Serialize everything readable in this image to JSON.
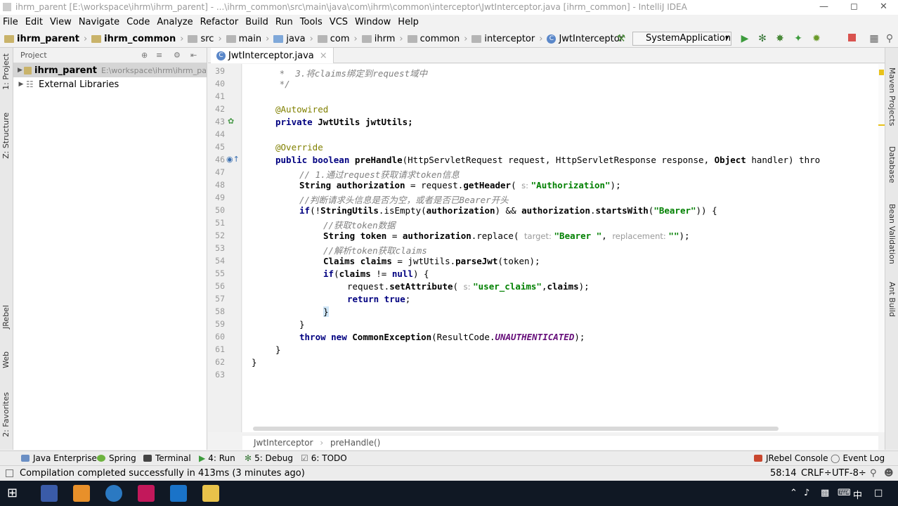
{
  "window": {
    "title": "ihrm_parent [E:\\workspace\\ihrm\\ihrm_parent] - ...\\ihrm_common\\src\\main\\java\\com\\ihrm\\common\\interceptor\\JwtInterceptor.java [ihrm_common] - IntelliJ IDEA"
  },
  "menu": [
    "File",
    "Edit",
    "View",
    "Navigate",
    "Code",
    "Analyze",
    "Refactor",
    "Build",
    "Run",
    "Tools",
    "VCS",
    "Window",
    "Help"
  ],
  "breadcrumbs": [
    "ihrm_parent",
    "ihrm_common",
    "src",
    "main",
    "java",
    "com",
    "ihrm",
    "common",
    "interceptor",
    "JwtInterceptor"
  ],
  "run_config": "SystemApplication",
  "left_tabs": [
    "1: Project",
    "Z: Structure",
    "JRebel",
    "Web",
    "2: Favorites"
  ],
  "right_tabs": [
    "Maven Projects",
    "Database",
    "Bean Validation",
    "Ant Build"
  ],
  "project_panel": {
    "header": "Project",
    "items": [
      {
        "label": "ihrm_parent",
        "path": "E:\\workspace\\ihrm\\ihrm_pa"
      },
      {
        "label": "External Libraries",
        "path": ""
      }
    ]
  },
  "editor": {
    "tab": "JwtInterceptor.java",
    "line_numbers": [
      "39",
      "40",
      "41",
      "42",
      "43",
      "44",
      "45",
      "46",
      "47",
      "48",
      "49",
      "50",
      "51",
      "52",
      "53",
      "54",
      "55",
      "56",
      "57",
      "58",
      "59",
      "60",
      "61",
      "62",
      "63"
    ],
    "lines": {
      "l39": "     *  3.将claims绑定到request域中",
      "l40": "     */",
      "l42": "@Autowired",
      "l43_kw": "private ",
      "l43_rest": "JwtUtils jwtUtils;",
      "l45": "@Override",
      "l46_kw": "public boolean ",
      "l46_fn": "preHandle",
      "l46_rest": "(HttpServletRequest request, HttpServletResponse response, ",
      "l46_obj": "Object",
      "l46_tail": " handler) thro",
      "l47": "// 1.通过request获取请求token信息",
      "l48_a": "String ",
      "l48_b": "authorization",
      "l48_c": " = request.",
      "l48_d": "getHeader",
      "l48_e": "( ",
      "l48_hint": "s: ",
      "l48_str": "\"Authorization\"",
      "l48_end": ");",
      "l49": "//判断请求头信息是否为空，或者是否已Bearer开头",
      "l50_kw": "if",
      "l50_a": "(!",
      "l50_b": "StringUtils",
      "l50_c": ".isEmpty(",
      "l50_d": "authorization",
      "l50_e": ") && ",
      "l50_f": "authorization",
      "l50_g": ".",
      "l50_h": "startsWith",
      "l50_i": "(",
      "l50_str": "\"Bearer\"",
      "l50_end": ")) {",
      "l51": "//获取token数据",
      "l52_a": "String ",
      "l52_b": "token",
      "l52_c": " = ",
      "l52_d": "authorization",
      "l52_e": ".replace( ",
      "l52_h1": "target: ",
      "l52_s1": "\"Bearer \"",
      "l52_m": ", ",
      "l52_h2": "replacement: ",
      "l52_s2": "\"\"",
      "l52_end": ");",
      "l53": "//解析token获取claims",
      "l54_a": "Claims ",
      "l54_b": "claims",
      "l54_c": " = jwtUtils.",
      "l54_d": "parseJwt",
      "l54_e": "(token);",
      "l55_kw": "if",
      "l55_a": "(",
      "l55_b": "claims",
      "l55_c": " != ",
      "l55_kw2": "null",
      "l55_d": ") {",
      "l56_a": "request.",
      "l56_b": "setAttribute",
      "l56_c": "( ",
      "l56_hint": "s: ",
      "l56_str": "\"user_claims\"",
      "l56_d": ",",
      "l56_e": "claims",
      "l56_end": ");",
      "l57_kw": "return true",
      "l57_end": ";",
      "l58": "}",
      "l59": "}",
      "l60_kw": "throw new ",
      "l60_a": "CommonException",
      "l60_b": "(ResultCode.",
      "l60_it": "UNAUTHENTICATED",
      "l60_end": ");",
      "l61": "}",
      "l62": "}"
    },
    "breadcrumb": [
      "JwtInterceptor",
      "preHandle()"
    ]
  },
  "tool_windows": {
    "left": [
      "Java Enterprise",
      "Spring",
      "Terminal",
      "4: Run",
      "5: Debug",
      "6: TODO"
    ],
    "right": [
      "JRebel Console",
      "Event Log"
    ]
  },
  "status": {
    "message": "Compilation completed successfully in 413ms (3 minutes ago)",
    "position": "58:14",
    "line_sep": "CRLF÷",
    "encoding": "UTF-8÷"
  },
  "colors": {
    "keyword": "#000080",
    "string": "#008000",
    "comment": "#808080",
    "annotation": "#808000",
    "taskbar": "#101824"
  }
}
